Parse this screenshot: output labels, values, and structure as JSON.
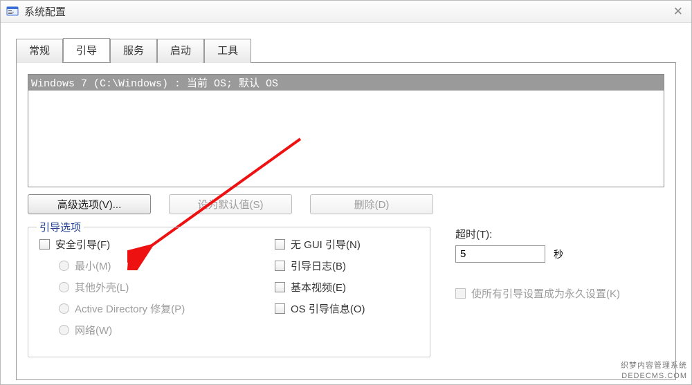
{
  "window": {
    "title": "系统配置"
  },
  "tabs": {
    "t0": "常规",
    "t1": "引导",
    "t2": "服务",
    "t3": "启动",
    "t4": "工具"
  },
  "bootlist": {
    "row0": "Windows 7 (C:\\Windows) : 当前 OS; 默认 OS"
  },
  "buttons": {
    "advanced": "高级选项(V)...",
    "setdefault": "设为默认值(S)",
    "delete": "删除(D)"
  },
  "group": {
    "legend": "引导选项",
    "safeboot": "安全引导(F)",
    "min": "最小(M)",
    "altshell": "其他外壳(L)",
    "adrepair": "Active Directory 修复(P)",
    "network": "网络(W)",
    "nogui": "无 GUI 引导(N)",
    "bootlog": "引导日志(B)",
    "basevideo": "基本视频(E)",
    "osbootinfo": "OS 引导信息(O)"
  },
  "timeout": {
    "label": "超时(T):",
    "value": "5",
    "unit": "秒"
  },
  "permanent": "使所有引导设置成为永久设置(K)",
  "watermark": {
    "line1": "织梦内容管理系统",
    "line2": "DEDECMS.COM"
  }
}
